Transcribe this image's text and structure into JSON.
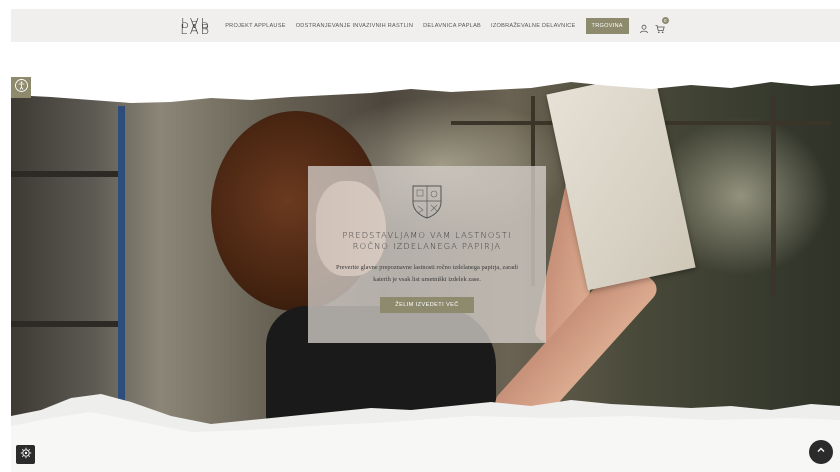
{
  "header": {
    "logo_top": "PAP",
    "logo_bottom": "LAB",
    "nav": [
      {
        "label": "PROJEKT APPLAUSE"
      },
      {
        "label": "ODSTRANJEVANJE INVAZIVNIH RASTLIN"
      },
      {
        "label": "DELAVNICA PAPLAB"
      },
      {
        "label": "IZOBRAŽEVALNE DELAVNICE"
      }
    ],
    "shop_label": "TRGOVINA",
    "user_icon": "user-icon",
    "cart_icon": "cart-icon",
    "cart_count": "0"
  },
  "hero": {
    "title_line1": "PREDSTAVLJAMO VAM LASTNOSTI",
    "title_line2": "ROČNO IZDELANEGA PAPIRJA",
    "text": "Preverite glavne prepoznavne lastnosti ročno izdelanega papirja, zaradi katerih je vsak list umetniški izdelek zase.",
    "button_label": "ŽELIM IZVEDETI VEČ",
    "crest_icon": "crest-icon"
  },
  "widgets": {
    "accessibility_icon": "accessibility-icon",
    "cookie_icon": "cookie-settings-icon",
    "scroll_top_icon": "chevron-up-icon"
  },
  "colors": {
    "accent": "#8d8a6d",
    "header_bg": "#f0efee",
    "dark_widget": "#2b2b2b"
  }
}
